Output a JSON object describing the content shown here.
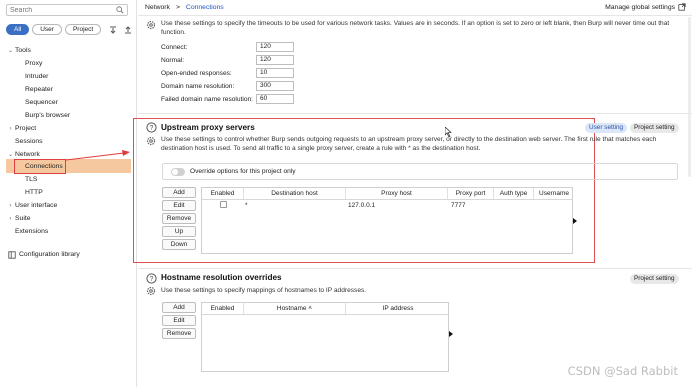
{
  "sidebar": {
    "search_placeholder": "Search",
    "filters": [
      "All",
      "User",
      "Project"
    ],
    "active_filter": "All",
    "items": [
      {
        "label": "Tools",
        "level": 0,
        "expanded": true
      },
      {
        "label": "Proxy",
        "level": 1
      },
      {
        "label": "Intruder",
        "level": 1
      },
      {
        "label": "Repeater",
        "level": 1
      },
      {
        "label": "Sequencer",
        "level": 1
      },
      {
        "label": "Burp's browser",
        "level": 1
      },
      {
        "label": "Project",
        "level": 0,
        "expanded": false
      },
      {
        "label": "Sessions",
        "level": 0
      },
      {
        "label": "Network",
        "level": 0,
        "expanded": true
      },
      {
        "label": "Connections",
        "level": 1,
        "selected": true
      },
      {
        "label": "TLS",
        "level": 1
      },
      {
        "label": "HTTP",
        "level": 1
      },
      {
        "label": "User interface",
        "level": 0,
        "expanded": false
      },
      {
        "label": "Suite",
        "level": 0,
        "expanded": false
      },
      {
        "label": "Extensions",
        "level": 0
      }
    ],
    "library_label": "Configuration library"
  },
  "topbar": {
    "breadcrumb": [
      "Network",
      ">",
      "Connections"
    ],
    "global_label": "Manage global settings"
  },
  "timeouts": {
    "description": "Use these settings to specify the timeouts to be used for various network tasks. Values are in seconds. If an option is set to zero or left blank, then Burp will never time out that function.",
    "fields": [
      {
        "label": "Connect:",
        "value": "120"
      },
      {
        "label": "Normal:",
        "value": "120"
      },
      {
        "label": "Open-ended responses:",
        "value": "10"
      },
      {
        "label": "Domain name resolution:",
        "value": "300"
      },
      {
        "label": "Failed domain name resolution:",
        "value": "60"
      }
    ]
  },
  "upstream": {
    "title": "Upstream proxy servers",
    "badge_user": "User setting",
    "badge_project": "Project setting",
    "description": "Use these settings to  control whether Burp sends outgoing requests to an upstream proxy server, or directly to the destination web server. The first rule that matches each destination host is used. To send all traffic to a single proxy server, create a rule with * as the destination host.",
    "override_label": "Override options for this project only",
    "buttons": [
      "Add",
      "Edit",
      "Remove",
      "Up",
      "Down"
    ],
    "columns": [
      "Enabled",
      "Destination host",
      "Proxy host",
      "Proxy port",
      "Auth type",
      "Username"
    ],
    "rows": [
      {
        "enabled": false,
        "destination": "*",
        "proxy_host": "127.0.0.1",
        "proxy_port": "7777",
        "auth": "",
        "username": ""
      }
    ]
  },
  "hostname": {
    "title": "Hostname resolution overrides",
    "badge_project": "Project setting",
    "description": "Use these settings to specify mappings of hostnames to IP addresses.",
    "buttons": [
      "Add",
      "Edit",
      "Remove"
    ],
    "columns": [
      "Enabled",
      "Hostname ˄",
      "IP address"
    ]
  },
  "watermark": "CSDN @Sad Rabbit",
  "colors": {
    "accent": "#3b6fc3",
    "selection": "#f6c89f",
    "highlight_red": "#e05050",
    "link": "#1f54c0"
  }
}
